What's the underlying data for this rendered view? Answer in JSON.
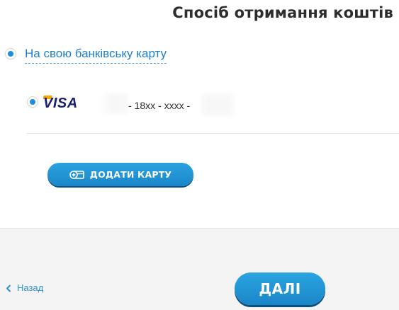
{
  "page_title": "Спосіб отримання коштів",
  "payout_method": {
    "label": "На свою банківську карту",
    "selected": true
  },
  "card": {
    "brand": "VISA",
    "masked_number": "- 18xx - xxxx -",
    "selected": true
  },
  "add_card_button": {
    "label": "ДОДАТИ КАРТУ",
    "icon": "add-card-icon"
  },
  "footer": {
    "back_label": "Назад",
    "next_label": "ДАЛІ"
  },
  "colors": {
    "accent": "#1a8fdc",
    "button": "#1a86c9",
    "link": "#1d7fc9",
    "visa_blue": "#1a1f71",
    "visa_gold": "#f7a600",
    "footer_bg": "#f4f4f4"
  }
}
